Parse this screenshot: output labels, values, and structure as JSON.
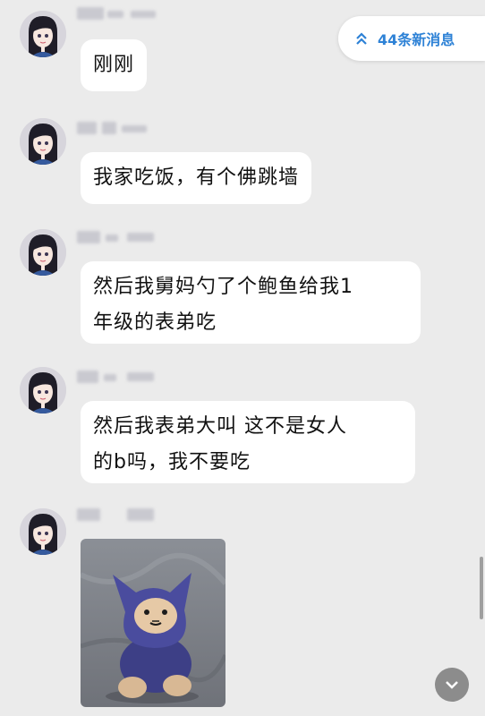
{
  "new_messages": {
    "label": "44条新消息",
    "icon": "double-chevron-up-icon",
    "color": "#2e82d6"
  },
  "messages": [
    {
      "text": "刚刚"
    },
    {
      "text": "我家吃饭，有个佛跳墙"
    },
    {
      "lines": [
        "然后我舅妈勺了个鲍鱼给我1",
        "年级的表弟吃"
      ]
    },
    {
      "lines": [
        "然后我表弟大叫  这不是女人",
        "的b吗，我不要吃"
      ]
    },
    {
      "sticker": "purple-hooded-cat-toy-sticker"
    }
  ],
  "scroll_down": {
    "icon": "chevron-down-icon"
  }
}
